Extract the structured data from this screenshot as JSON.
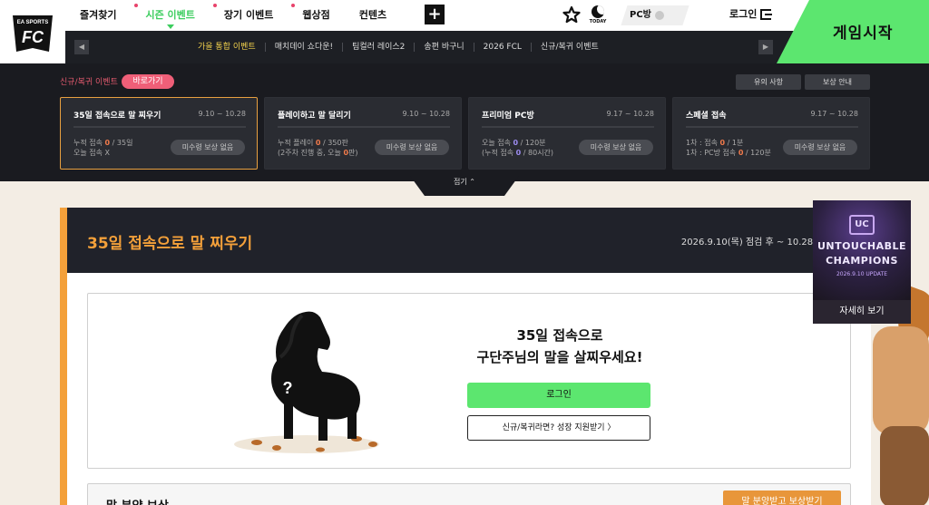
{
  "brand": {
    "logo_text": "EA SPORTS",
    "logo_mark": "FC"
  },
  "nav": {
    "items": [
      {
        "label": "즐겨찾기"
      },
      {
        "label": "시즌 이벤트"
      },
      {
        "label": "장기 이벤트"
      },
      {
        "label": "웹상점"
      },
      {
        "label": "컨텐츠"
      }
    ],
    "plus_icon": "plus-icon"
  },
  "header": {
    "today_label": "TODAY",
    "pc_label": "PC방",
    "login_label": "로그인",
    "game_start_label": "게임시작"
  },
  "subnav": {
    "items": [
      "가을 통합 이벤트",
      "매치데이 쇼다운!",
      "팀컬러 레이스2",
      "송편 바구니",
      "2026 FCL",
      "신규/복귀 이벤트"
    ]
  },
  "panel": {
    "title": "신규/복귀 이벤트",
    "goto_label": "바로가기",
    "notice_label": "유의 사항",
    "reward_guide_label": "보상 안내",
    "fold_label": "접기",
    "cards": [
      {
        "title": "35일 접속으로 말 찌우기",
        "date": "9.10 ~ 10.28",
        "line1_prefix": "누적 접속 ",
        "line1_value": "0",
        "line1_suffix": " / 35일",
        "line2": "오늘 접속 X",
        "button": "미수령 보상 없음"
      },
      {
        "title": "플레이하고 말 달리기",
        "date": "9.10 ~ 10.28",
        "line1_prefix": "누적 플레이 ",
        "line1_value": "0",
        "line1_suffix": " / 350판",
        "line2_prefix": "(2주차 진행 중, 오늘 ",
        "line2_value": "0",
        "line2_suffix": "판)",
        "button": "미수령 보상 없음"
      },
      {
        "title": "프리미엄 PC방",
        "date": "9.17 ~ 10.28",
        "line1_prefix": "오늘 접속 ",
        "line1_value": "0",
        "line1_suffix": " / 120분",
        "line2_prefix": "(누적 접속 ",
        "line2_value": "0",
        "line2_suffix": " / 80시간)",
        "button": "미수령 보상 없음"
      },
      {
        "title": "스페셜 접속",
        "date": "9.17 ~ 10.28",
        "line1_prefix": "1차 : 접속 ",
        "line1_value": "0",
        "line1_suffix": " / 1분",
        "line2_prefix": "1차 : PC방 접속 ",
        "line2_value": "0",
        "line2_suffix": " / 120분",
        "button": "미수령 보상 없음"
      }
    ]
  },
  "main": {
    "title": "35일 접속으로 말 찌우기",
    "date": "2026.9.10(목) 점검 후 ~ 10.28(",
    "cta_line1": "35일 접속으로",
    "cta_line2": "구단주님의 말을 살찌우세요!",
    "login_button": "로그인",
    "support_button": "신규/복귀라면? 성장 지원받기 〉",
    "horse_mark": "?",
    "reward_title": "말 분양 보상",
    "reward_button": "말 분양받고 보상받기"
  },
  "banner": {
    "logo_text": "UC",
    "line1": "UNTOUCHABLE",
    "line2": "CHAMPIONS",
    "line3": "2026.9.10 UPDATE",
    "more_label": "자세히 보기"
  },
  "colors": {
    "accent_green": "#5ce66f",
    "accent_orange": "#f3a03a",
    "accent_pink": "#ef5f78",
    "dark_panel": "#1a1b20"
  }
}
